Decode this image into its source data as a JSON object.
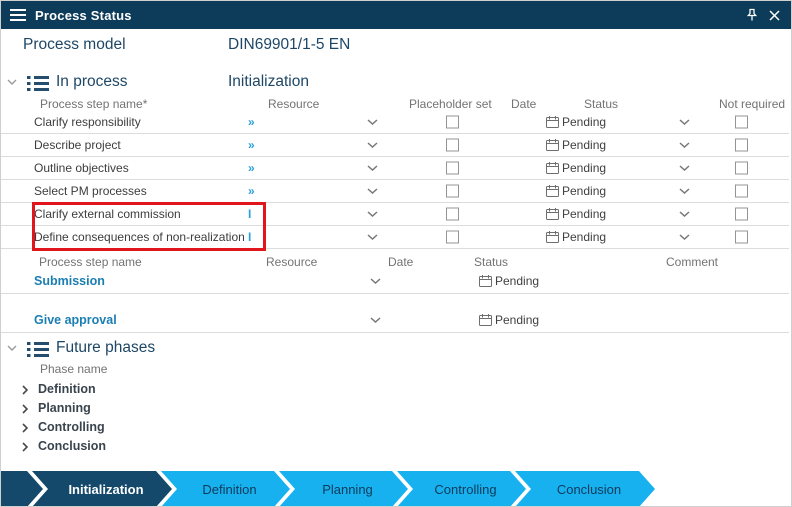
{
  "titlebar": {
    "title": "Process Status"
  },
  "process_model": {
    "label": "Process model",
    "value": "DIN69901/1-5 EN"
  },
  "in_process": {
    "title": "In process",
    "phase": "Initialization",
    "steps": {
      "headers": {
        "name": "Process step name*",
        "resource": "Resource",
        "placeholder_set": "Placeholder set",
        "date": "Date",
        "status": "Status",
        "not_required": "Not required"
      },
      "rows": [
        {
          "name": "Clarify responsibility",
          "resource": "»",
          "status": "Pending",
          "highlighted": false
        },
        {
          "name": "Describe project",
          "resource": "»",
          "status": "Pending",
          "highlighted": false
        },
        {
          "name": "Outline objectives",
          "resource": "»",
          "status": "Pending",
          "highlighted": false
        },
        {
          "name": "Select PM processes",
          "resource": "»",
          "status": "Pending",
          "highlighted": false
        },
        {
          "name": "Clarify external commission",
          "resource": "I",
          "status": "Pending",
          "highlighted": true
        },
        {
          "name": "Define consequences of non-realization",
          "resource": "I",
          "status": "Pending",
          "highlighted": true
        }
      ]
    },
    "milestones": {
      "headers": {
        "name": "Process step name",
        "resource": "Resource",
        "date": "Date",
        "status": "Status",
        "comment": "Comment"
      },
      "rows": [
        {
          "name": "Submission",
          "status": "Pending"
        },
        {
          "name": "Give approval",
          "status": "Pending"
        }
      ]
    }
  },
  "future_phases": {
    "title": "Future phases",
    "header": "Phase name",
    "items": [
      {
        "name": "Definition"
      },
      {
        "name": "Planning"
      },
      {
        "name": "Controlling"
      },
      {
        "name": "Conclusion"
      }
    ]
  },
  "phase_bar": {
    "items": [
      {
        "label": "Initialization",
        "active": true
      },
      {
        "label": "Definition",
        "active": false
      },
      {
        "label": "Planning",
        "active": false
      },
      {
        "label": "Controlling",
        "active": false
      },
      {
        "label": "Conclusion",
        "active": false
      }
    ]
  },
  "colors": {
    "titlebar_bg": "#0d3b5a",
    "accent_blue": "#18b1f0",
    "active_phase_bg": "#15496b",
    "link_blue": "#1b7eb3",
    "resource_glyph_blue": "#2aa0dc",
    "highlight_red": "#e0161c",
    "section_title": "#1e4766"
  }
}
